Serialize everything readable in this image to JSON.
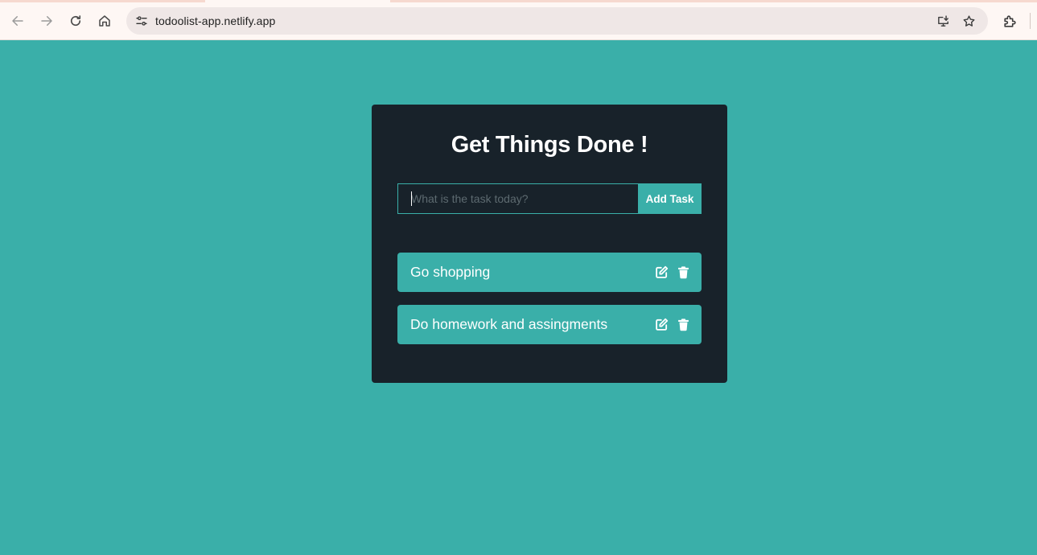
{
  "browser": {
    "url": "todoolist-app.netlify.app",
    "icons": {
      "back": "arrow-left-icon",
      "forward": "arrow-right-icon",
      "reload": "reload-icon",
      "home": "home-icon",
      "site_info": "tune-icon",
      "install": "install-app-icon",
      "bookmark": "star-icon",
      "extensions": "puzzle-icon"
    }
  },
  "app": {
    "title": "Get Things Done !",
    "input_placeholder": "What is the task today?",
    "add_button_label": "Add Task",
    "todos": [
      {
        "text": "Go shopping"
      },
      {
        "text": "Do homework and assingments"
      }
    ]
  },
  "colors": {
    "background": "#3aafa9",
    "card": "#18222a",
    "accent": "#3aafa9",
    "text": "#ffffff"
  }
}
